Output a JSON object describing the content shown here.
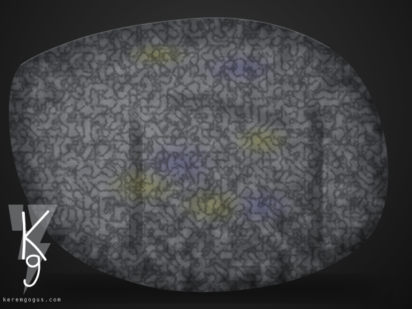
{
  "watermark": {
    "logo_letters": "Kg",
    "url": "keremgogus.com"
  },
  "colors": {
    "background_center": "#3b3b3b",
    "background_edge": "#101010",
    "rock_base": "#4a4c50",
    "rock_highlight": "#8a8c90",
    "rock_shadow": "#1a1a1c",
    "lichen_tint": "#8a8a4a",
    "mineral_tint": "#5a5a8a"
  }
}
